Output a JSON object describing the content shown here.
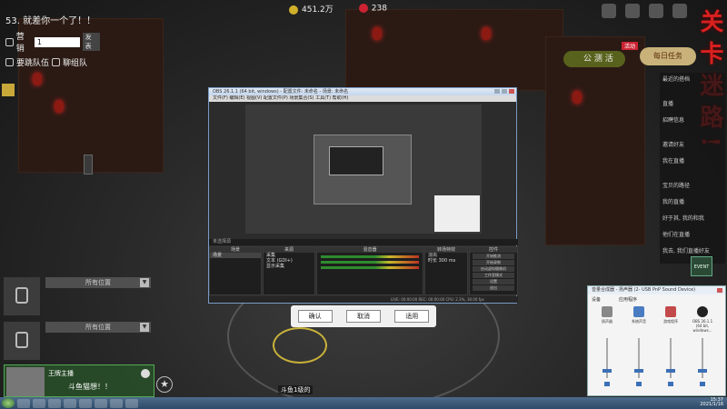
{
  "quest": {
    "title": "53. 就差你一个了！！",
    "row1_label": "营销",
    "row1_value": "1",
    "row1_tag": "发表",
    "row2_label": "要跳队伍",
    "row2_tag": "聊组队"
  },
  "topbar": {
    "coins": "451.2万",
    "gems": "238"
  },
  "right": {
    "red_vertical_text": "关 卡 迷 路 !",
    "pill_label": "公 测 活",
    "banner": "活动",
    "mini_box": "每日任务",
    "task_items": [
      "最近的搭档",
      "",
      "直播",
      "招聘信息",
      "",
      "邀请好友",
      "我在直播",
      "",
      "宝贝的路径",
      "我的直播",
      "好于其, 我的和我",
      "他们在直播",
      "我去, 我们直播好友"
    ],
    "event_label": "EVENT"
  },
  "slots": {
    "select_label_1": "所有位置",
    "select_label_2": "所有位置"
  },
  "player": {
    "name": "王牌主播",
    "message": "斗鱼猫想！！"
  },
  "bottom_label": "斗鱼1级的",
  "confirm": {
    "ok": "确认",
    "cancel": "取消",
    "apply": "适用"
  },
  "obs": {
    "title": "OBS 26.1.1 (64 bit, windows) - 配置文件: 未命名 - 场景: 未命名",
    "menu": "文件(F)  编辑(E)  视图(V)  配置文件(P)  场景集合(S)  工具(T)  帮助(H)",
    "scene_bar": "未选择源",
    "panels": {
      "scenes": "场景",
      "sources": "来源",
      "mixer": "混音器",
      "transitions": "转场特效",
      "controls": "控件"
    },
    "scene_item": "场景",
    "sources": [
      "采集",
      "文本 (GDI+)",
      "显示采集"
    ],
    "transition_value": "淡出",
    "duration_label": "时长",
    "duration_value": "300 ms",
    "control_buttons": [
      "开始推流",
      "开始录制",
      "启动虚拟摄像机",
      "工作室模式",
      "设置",
      "退出"
    ],
    "status": "LIVE: 00:00:00  REC: 00:00:00  CPU: 2.3%, 30.00 fps"
  },
  "mixer_window": {
    "title": "音量合成器 - 扬声器 (2- USB PnP Sound Device)",
    "device_header": "设备",
    "apps_header": "应用程序",
    "apps": [
      "扬声器",
      "系统声音",
      "游戏程序",
      "OBS 26.1.1 (64 bit, windows..."
    ],
    "levels": [
      0.15,
      0.15,
      0.15,
      0.15
    ]
  },
  "taskbar": {
    "time": "15:37",
    "date": "2021/1/16"
  },
  "colors": {
    "red_text": "#d92020",
    "obs_border": "#7a9bc4",
    "mixer_thumb": "#3c6fb6"
  }
}
